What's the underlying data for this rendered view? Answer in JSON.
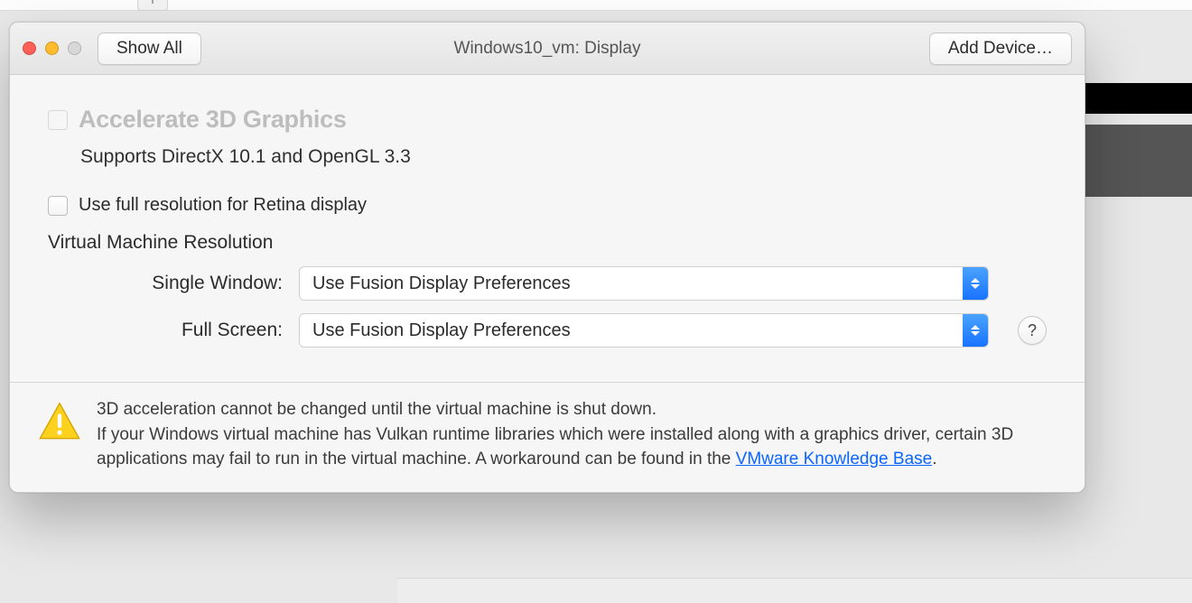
{
  "titlebar": {
    "show_all": "Show All",
    "title": "Windows10_vm: Display",
    "add_device": "Add Device…"
  },
  "accel3d": {
    "label": "Accelerate 3D Graphics",
    "subtext": "Supports DirectX 10.1 and OpenGL 3.3"
  },
  "retina": {
    "label": "Use full resolution for Retina display"
  },
  "vm_res": {
    "heading": "Virtual Machine Resolution",
    "single_window_label": "Single Window:",
    "single_window_value": "Use Fusion Display Preferences",
    "full_screen_label": "Full Screen:",
    "full_screen_value": "Use Fusion Display Preferences"
  },
  "help": {
    "glyph": "?"
  },
  "footer": {
    "line1": "3D acceleration cannot be changed until the virtual machine is shut down.",
    "line2a": "If your Windows virtual machine has Vulkan runtime libraries which were installed along with a graphics driver, certain 3D applications may fail to run in the virtual machine. A workaround can be found in the ",
    "link": "VMware Knowledge Base",
    "line2b": "."
  }
}
